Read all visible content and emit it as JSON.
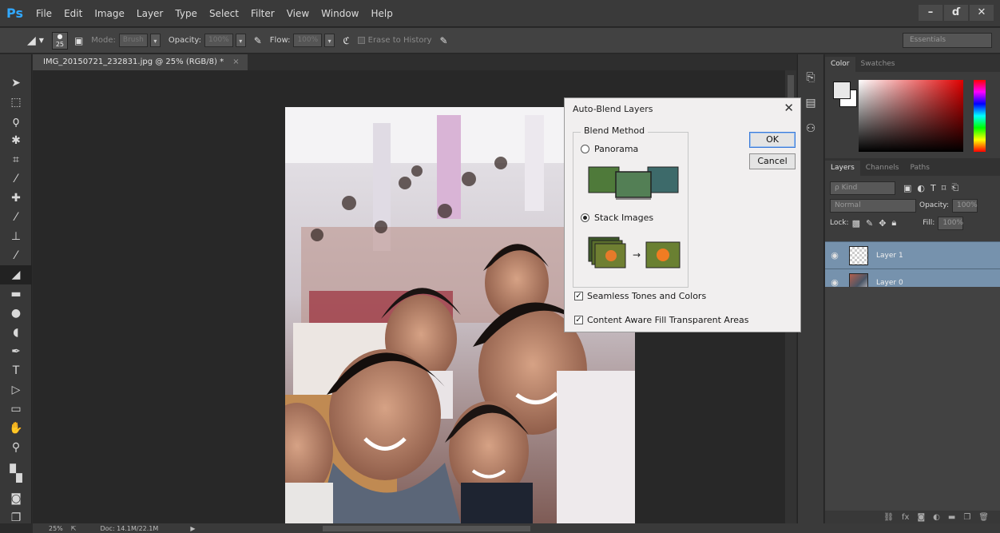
{
  "app": {
    "logo": "Ps",
    "menu": [
      "File",
      "Edit",
      "Image",
      "Layer",
      "Type",
      "Select",
      "Filter",
      "View",
      "Window",
      "Help"
    ],
    "window_controls": [
      "–",
      "ɗ",
      "✕"
    ]
  },
  "options_bar": {
    "brush_size": "25",
    "mode_label": "Mode:",
    "mode_value": "Brush",
    "opacity_label": "Opacity:",
    "opacity_value": "100%",
    "flow_label": "Flow:",
    "flow_value": "100%",
    "erase_history_label": "Erase to History",
    "workspace": "Essentials"
  },
  "document": {
    "tab_title": "IMG_20150721_232831.jpg @ 25% (RGB/8) *",
    "tab_close": "×"
  },
  "status_bar": {
    "zoom": "25%",
    "doc_info": "Doc: 14.1M/22.1M"
  },
  "dialog": {
    "title": "Auto-Blend Layers",
    "blend_method_label": "Blend Method",
    "panorama_label": "Panorama",
    "stack_images_label": "Stack Images",
    "selected_method": "Stack Images",
    "seamless_label": "Seamless Tones and Colors",
    "seamless_checked": true,
    "content_aware_label": "Content Aware Fill Transparent Areas",
    "content_aware_checked": true,
    "ok_label": "OK",
    "cancel_label": "Cancel",
    "close_glyph": "✕"
  },
  "panels": {
    "color_tabs": [
      "Color",
      "Swatches"
    ],
    "layers_tabs": [
      "Layers",
      "Channels",
      "Paths"
    ],
    "filter_kind": "ρ Kind",
    "blend_mode": "Normal",
    "opacity_label": "Opacity:",
    "opacity_value": "100%",
    "lock_label": "Lock:",
    "fill_label": "Fill:",
    "fill_value": "100%",
    "layers": [
      {
        "name": "Layer 1"
      },
      {
        "name": "Layer 0"
      }
    ]
  },
  "colors": {
    "accent": "#31a8ff",
    "layer_selected": "#7692ad"
  }
}
